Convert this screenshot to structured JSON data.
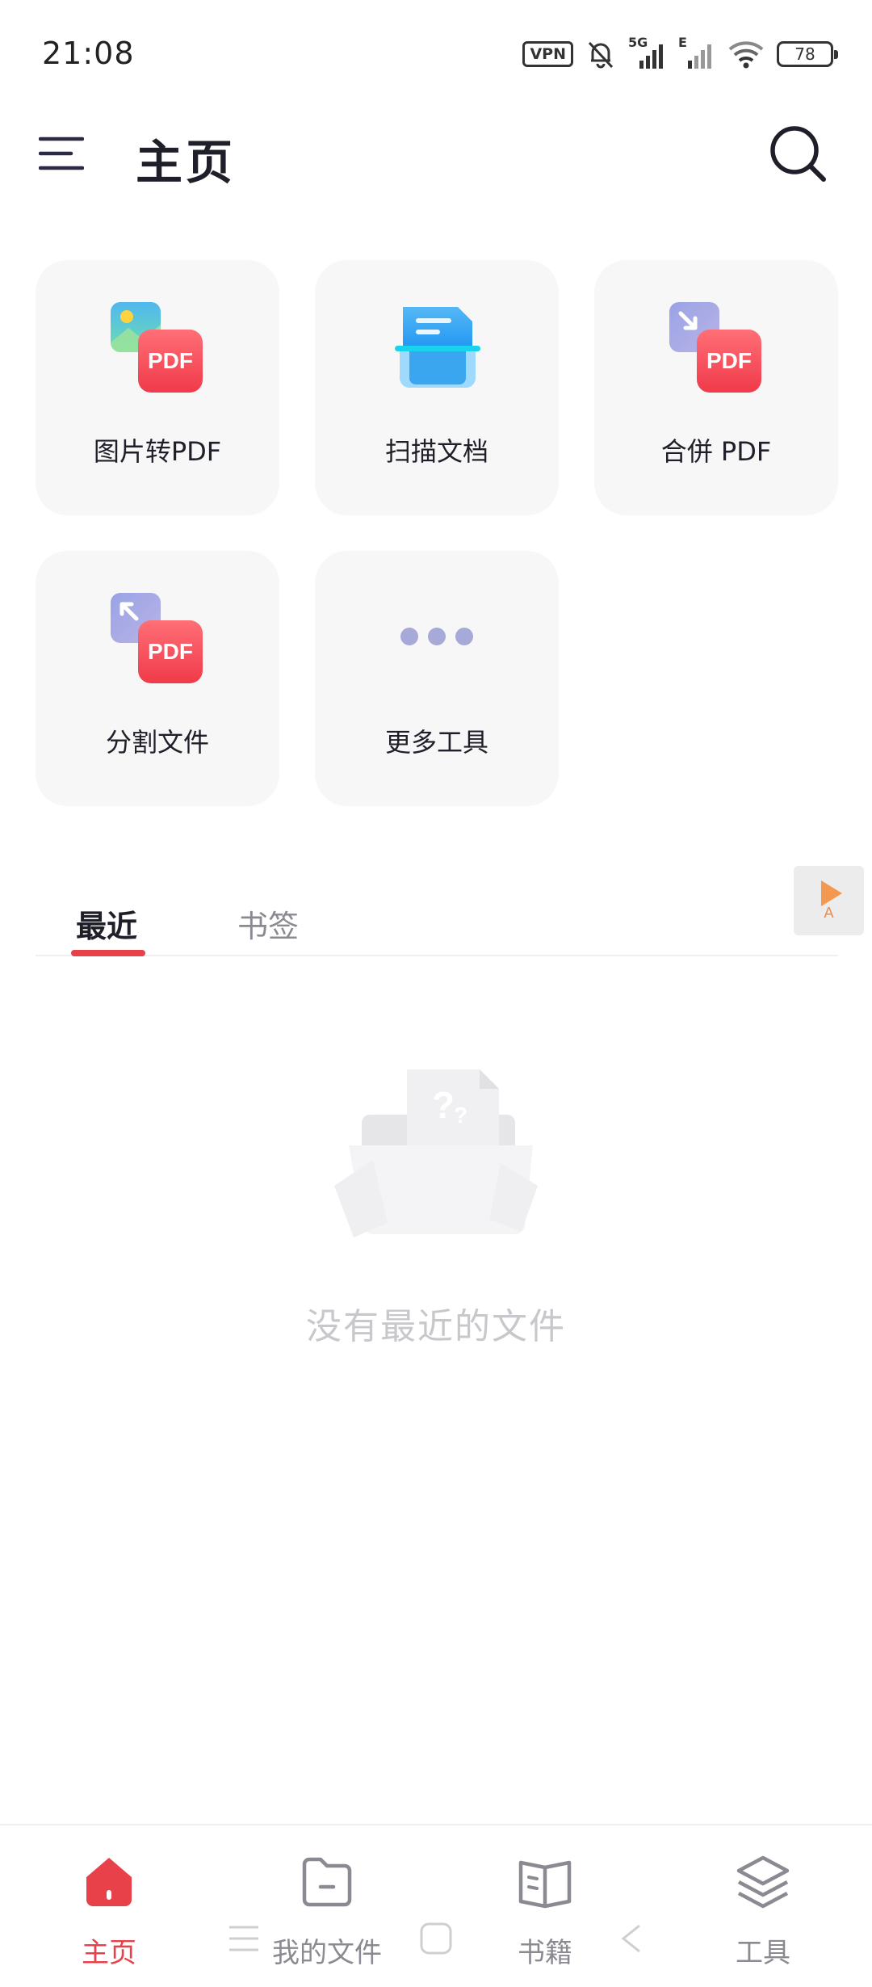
{
  "status_bar": {
    "time": "21:08",
    "vpn": "VPN",
    "network_5g": "5G",
    "network_e": "E",
    "battery": "78"
  },
  "header": {
    "title": "主页",
    "menu_icon": "hamburger-menu-icon",
    "search_icon": "search-icon"
  },
  "tools": [
    {
      "label": "图片转PDF",
      "icon": "image-to-pdf-icon",
      "badge": "PDF"
    },
    {
      "label": "扫描文档",
      "icon": "scan-document-icon"
    },
    {
      "label": "合併 PDF",
      "icon": "merge-pdf-icon",
      "badge": "PDF"
    },
    {
      "label": "分割文件",
      "icon": "split-file-icon",
      "badge": "PDF"
    },
    {
      "label": "更多工具",
      "icon": "more-dots-icon"
    }
  ],
  "ad_badge": {
    "letter": "A"
  },
  "tabs": [
    {
      "label": "最近",
      "active": true
    },
    {
      "label": "书签",
      "active": false
    }
  ],
  "empty_state": {
    "text": "没有最近的文件",
    "illustration": "empty-folder-question-icon"
  },
  "bottom_nav": [
    {
      "label": "主页",
      "icon": "home-icon",
      "active": true
    },
    {
      "label": "我的文件",
      "icon": "folder-icon",
      "active": false
    },
    {
      "label": "书籍",
      "icon": "book-icon",
      "active": false
    },
    {
      "label": "工具",
      "icon": "layers-icon",
      "active": false
    }
  ],
  "colors": {
    "accent": "#e8414a",
    "card_bg": "#f7f7f8",
    "text_primary": "#1f1f2a",
    "text_secondary": "#8a8a92",
    "empty_text": "#c8c8cc"
  }
}
